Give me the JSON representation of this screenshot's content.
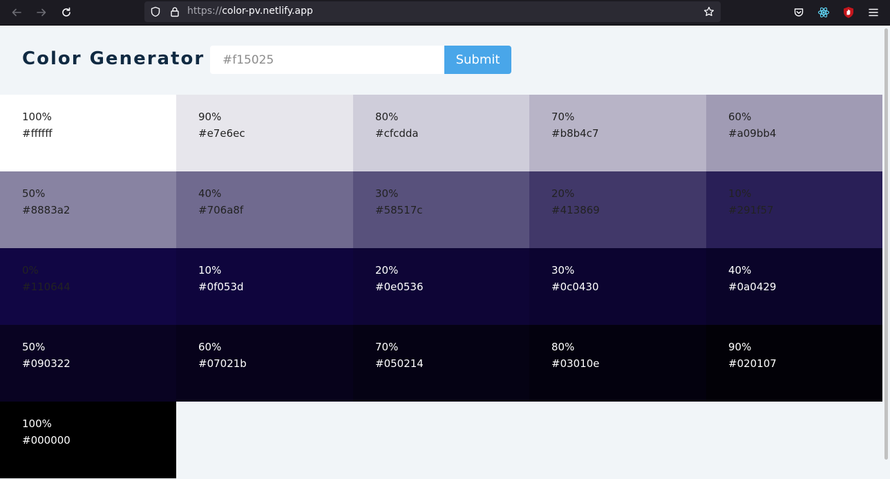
{
  "browser": {
    "url_scheme": "https://",
    "url_host": "color-pv.netlify.app"
  },
  "app": {
    "title": "Color Generator",
    "input_placeholder": "#f15025",
    "submit_label": "Submit"
  },
  "colors": [
    {
      "percent": "100%",
      "hex": "#ffffff",
      "bg": "#ffffff",
      "text": "#222222"
    },
    {
      "percent": "90%",
      "hex": "#e7e6ec",
      "bg": "#e7e6ec",
      "text": "#222222"
    },
    {
      "percent": "80%",
      "hex": "#cfcdda",
      "bg": "#cfcdda",
      "text": "#222222"
    },
    {
      "percent": "70%",
      "hex": "#b8b4c7",
      "bg": "#b8b4c7",
      "text": "#222222"
    },
    {
      "percent": "60%",
      "hex": "#a09bb4",
      "bg": "#a09bb4",
      "text": "#222222"
    },
    {
      "percent": "50%",
      "hex": "#8883a2",
      "bg": "#8883a2",
      "text": "#222222"
    },
    {
      "percent": "40%",
      "hex": "#706a8f",
      "bg": "#706a8f",
      "text": "#222222"
    },
    {
      "percent": "30%",
      "hex": "#58517c",
      "bg": "#58517c",
      "text": "#222222"
    },
    {
      "percent": "20%",
      "hex": "#413869",
      "bg": "#413869",
      "text": "#222222"
    },
    {
      "percent": "10%",
      "hex": "#291f57",
      "bg": "#291f57",
      "text": "#222222"
    },
    {
      "percent": "0%",
      "hex": "#110644",
      "bg": "#110644",
      "text": "#222222"
    },
    {
      "percent": "10%",
      "hex": "#0f053d",
      "bg": "#0f053d",
      "text": "#ffffff"
    },
    {
      "percent": "20%",
      "hex": "#0e0536",
      "bg": "#0e0536",
      "text": "#ffffff"
    },
    {
      "percent": "30%",
      "hex": "#0c0430",
      "bg": "#0c0430",
      "text": "#ffffff"
    },
    {
      "percent": "40%",
      "hex": "#0a0429",
      "bg": "#0a0429",
      "text": "#ffffff"
    },
    {
      "percent": "50%",
      "hex": "#090322",
      "bg": "#090322",
      "text": "#ffffff"
    },
    {
      "percent": "60%",
      "hex": "#07021b",
      "bg": "#07021b",
      "text": "#ffffff"
    },
    {
      "percent": "70%",
      "hex": "#050214",
      "bg": "#050214",
      "text": "#ffffff"
    },
    {
      "percent": "80%",
      "hex": "#03010e",
      "bg": "#03010e",
      "text": "#ffffff"
    },
    {
      "percent": "90%",
      "hex": "#020107",
      "bg": "#020107",
      "text": "#ffffff"
    },
    {
      "percent": "100%",
      "hex": "#000000",
      "bg": "#000000",
      "text": "#ffffff"
    }
  ],
  "icons": {
    "back": "back-arrow-icon",
    "forward": "forward-arrow-icon",
    "reload": "reload-icon",
    "shield": "tracking-shield-icon",
    "lock": "lock-icon",
    "bookmark": "bookmark-star-icon",
    "pocket": "pocket-icon",
    "react": "react-devtools-icon",
    "extension": "ublock-icon",
    "menu": "hamburger-menu-icon"
  }
}
